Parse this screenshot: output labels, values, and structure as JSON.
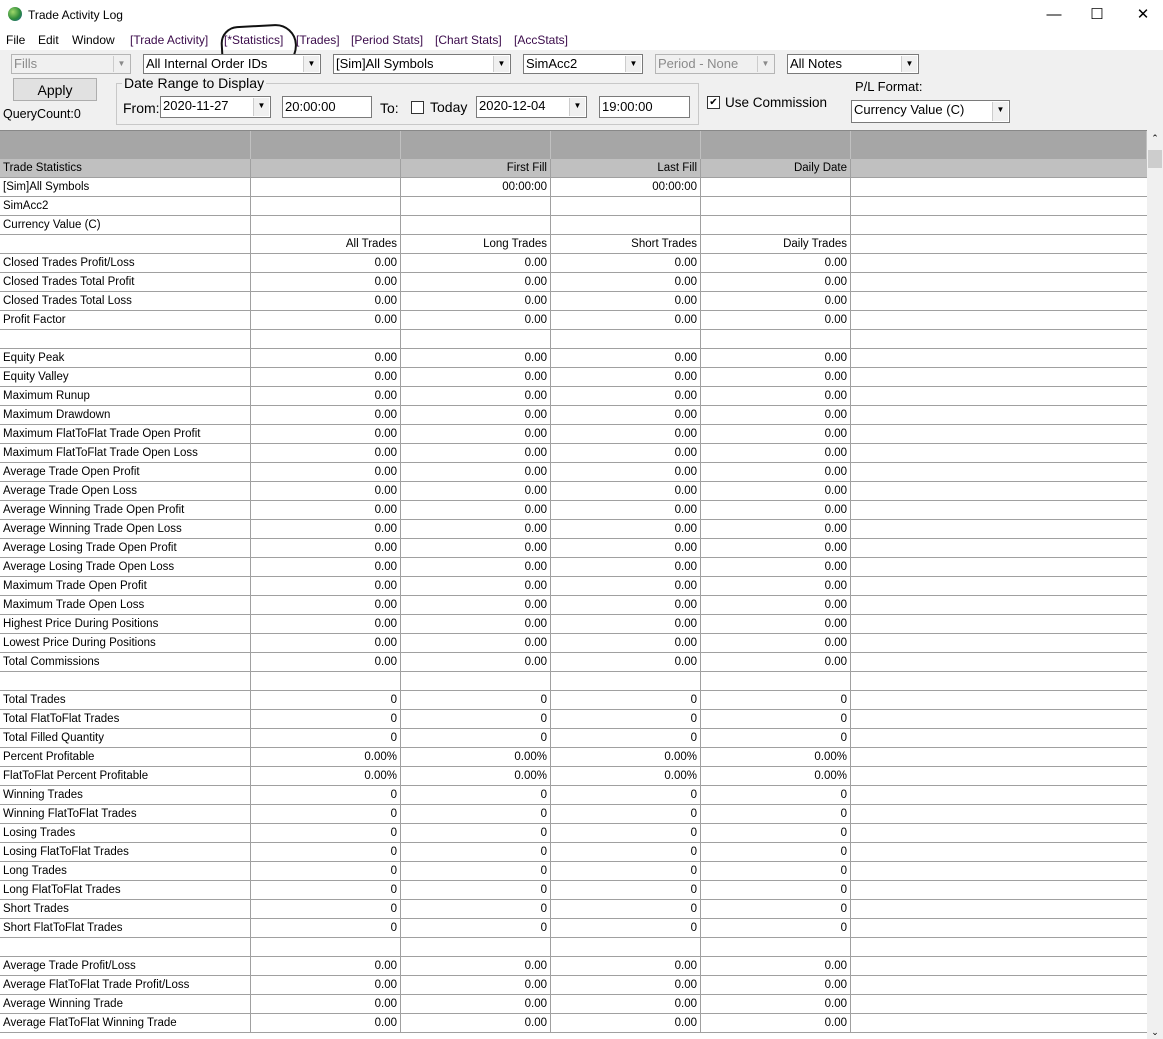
{
  "window": {
    "title": "Trade Activity Log",
    "minimize": "—",
    "maximize": "☐",
    "close": "✕"
  },
  "menu": [
    "File",
    "Edit",
    "Window",
    "[Trade Activity]",
    "[*Statistics]",
    "[Trades]",
    "[Period Stats]",
    "[Chart Stats]",
    "[AccStats]"
  ],
  "filters": {
    "type": "Fills",
    "order_ids": "All Internal Order IDs",
    "symbols": "[Sim]All Symbols",
    "account": "SimAcc2",
    "period": "Period - None",
    "notes": "All Notes"
  },
  "apply_label": "Apply",
  "query_count": "QueryCount:0",
  "date_range": {
    "label": "Date Range to Display",
    "from_label": "From:",
    "from_date": "2020-11-27",
    "from_time": "20:00:00",
    "to_label": "To:",
    "today_label": "Today",
    "today_checked": false,
    "to_date": "2020-12-04",
    "to_time": "19:00:00"
  },
  "use_commission": {
    "label": "Use Commission",
    "checked": true
  },
  "pl_format": {
    "label": "P/L Format:",
    "value": "Currency Value (C)"
  },
  "table": {
    "rows": [
      [
        "Trade Statistics",
        "",
        "First Fill",
        "Last Fill",
        "Daily Date"
      ],
      [
        "[Sim]All Symbols",
        "",
        "00:00:00",
        "00:00:00",
        ""
      ],
      [
        "SimAcc2",
        "",
        "",
        "",
        ""
      ],
      [
        "Currency Value (C)",
        "",
        "",
        "",
        ""
      ],
      [
        "",
        "All Trades",
        "Long Trades",
        "Short Trades",
        "Daily Trades"
      ],
      [
        "Closed Trades Profit/Loss",
        "0.00",
        "0.00",
        "0.00",
        "0.00"
      ],
      [
        "Closed Trades Total Profit",
        "0.00",
        "0.00",
        "0.00",
        "0.00"
      ],
      [
        "Closed Trades Total Loss",
        "0.00",
        "0.00",
        "0.00",
        "0.00"
      ],
      [
        "Profit Factor",
        "0.00",
        "0.00",
        "0.00",
        "0.00"
      ],
      [
        "",
        "",
        "",
        "",
        ""
      ],
      [
        "Equity Peak",
        "0.00",
        "0.00",
        "0.00",
        "0.00"
      ],
      [
        "Equity Valley",
        "0.00",
        "0.00",
        "0.00",
        "0.00"
      ],
      [
        "Maximum Runup",
        "0.00",
        "0.00",
        "0.00",
        "0.00"
      ],
      [
        "Maximum Drawdown",
        "0.00",
        "0.00",
        "0.00",
        "0.00"
      ],
      [
        "Maximum FlatToFlat Trade Open Profit",
        "0.00",
        "0.00",
        "0.00",
        "0.00"
      ],
      [
        "Maximum FlatToFlat Trade Open Loss",
        "0.00",
        "0.00",
        "0.00",
        "0.00"
      ],
      [
        "Average Trade Open Profit",
        "0.00",
        "0.00",
        "0.00",
        "0.00"
      ],
      [
        "Average Trade Open Loss",
        "0.00",
        "0.00",
        "0.00",
        "0.00"
      ],
      [
        "Average Winning Trade Open Profit",
        "0.00",
        "0.00",
        "0.00",
        "0.00"
      ],
      [
        "Average Winning Trade Open Loss",
        "0.00",
        "0.00",
        "0.00",
        "0.00"
      ],
      [
        "Average Losing Trade Open Profit",
        "0.00",
        "0.00",
        "0.00",
        "0.00"
      ],
      [
        "Average Losing Trade Open Loss",
        "0.00",
        "0.00",
        "0.00",
        "0.00"
      ],
      [
        "Maximum Trade Open Profit",
        "0.00",
        "0.00",
        "0.00",
        "0.00"
      ],
      [
        "Maximum Trade Open Loss",
        "0.00",
        "0.00",
        "0.00",
        "0.00"
      ],
      [
        "Highest Price During Positions",
        "0.00",
        "0.00",
        "0.00",
        "0.00"
      ],
      [
        "Lowest Price During Positions",
        "0.00",
        "0.00",
        "0.00",
        "0.00"
      ],
      [
        "Total Commissions",
        "0.00",
        "0.00",
        "0.00",
        "0.00"
      ],
      [
        "",
        "",
        "",
        "",
        ""
      ],
      [
        "Total Trades",
        "0",
        "0",
        "0",
        "0"
      ],
      [
        "Total FlatToFlat Trades",
        "0",
        "0",
        "0",
        "0"
      ],
      [
        "Total Filled Quantity",
        "0",
        "0",
        "0",
        "0"
      ],
      [
        "Percent Profitable",
        "0.00%",
        "0.00%",
        "0.00%",
        "0.00%"
      ],
      [
        "FlatToFlat Percent Profitable",
        "0.00%",
        "0.00%",
        "0.00%",
        "0.00%"
      ],
      [
        "Winning Trades",
        "0",
        "0",
        "0",
        "0"
      ],
      [
        "Winning FlatToFlat Trades",
        "0",
        "0",
        "0",
        "0"
      ],
      [
        "Losing Trades",
        "0",
        "0",
        "0",
        "0"
      ],
      [
        "Losing FlatToFlat Trades",
        "0",
        "0",
        "0",
        "0"
      ],
      [
        "Long Trades",
        "0",
        "0",
        "0",
        "0"
      ],
      [
        "Long FlatToFlat Trades",
        "0",
        "0",
        "0",
        "0"
      ],
      [
        "Short Trades",
        "0",
        "0",
        "0",
        "0"
      ],
      [
        "Short FlatToFlat Trades",
        "0",
        "0",
        "0",
        "0"
      ],
      [
        "",
        "",
        "",
        "",
        ""
      ],
      [
        "Average Trade Profit/Loss",
        "0.00",
        "0.00",
        "0.00",
        "0.00"
      ],
      [
        "Average FlatToFlat Trade Profit/Loss",
        "0.00",
        "0.00",
        "0.00",
        "0.00"
      ],
      [
        "Average Winning Trade",
        "0.00",
        "0.00",
        "0.00",
        "0.00"
      ],
      [
        "Average FlatToFlat Winning Trade",
        "0.00",
        "0.00",
        "0.00",
        "0.00"
      ]
    ]
  }
}
